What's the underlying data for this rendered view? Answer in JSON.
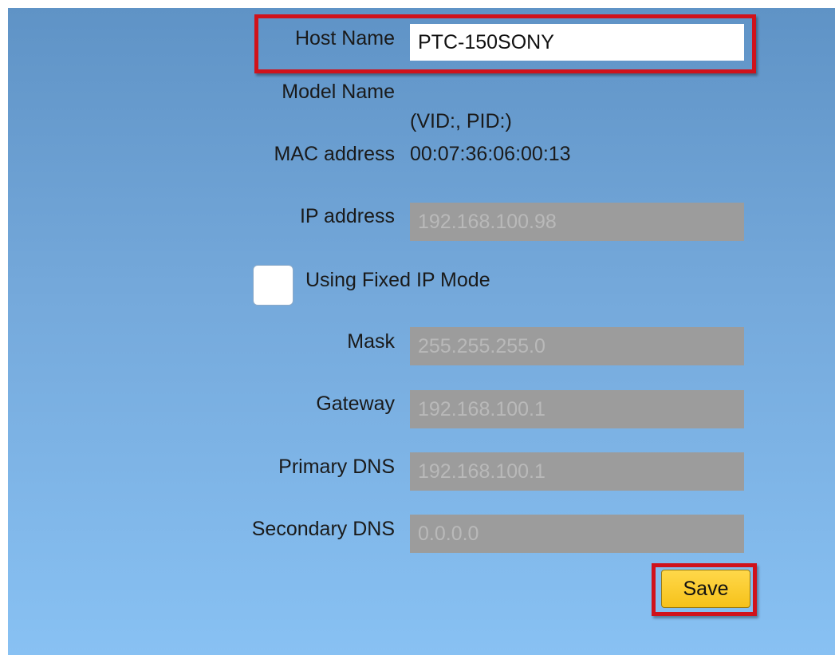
{
  "form": {
    "host_name": {
      "label": "Host Name",
      "value": "PTC-150SONY"
    },
    "model_name": {
      "label": "Model Name",
      "value": "(VID:, PID:)"
    },
    "mac_address": {
      "label": "MAC address",
      "value": "00:07:36:06:00:13"
    },
    "ip_address": {
      "label": "IP address",
      "value": "192.168.100.98"
    },
    "fixed_ip": {
      "label": "Using Fixed IP Mode",
      "checked": false
    },
    "mask": {
      "label": "Mask",
      "value": "255.255.255.0"
    },
    "gateway": {
      "label": "Gateway",
      "value": "192.168.100.1"
    },
    "primary_dns": {
      "label": "Primary DNS",
      "value": "192.168.100.1"
    },
    "secondary_dns": {
      "label": "Secondary DNS",
      "value": "0.0.0.0"
    },
    "save_label": "Save"
  },
  "colors": {
    "panel_top": "#5f93c6",
    "panel_bottom": "#88c1f3",
    "highlight": "#d0121b",
    "save_button": "#f6c21a",
    "disabled_field": "#9c9c9c"
  }
}
